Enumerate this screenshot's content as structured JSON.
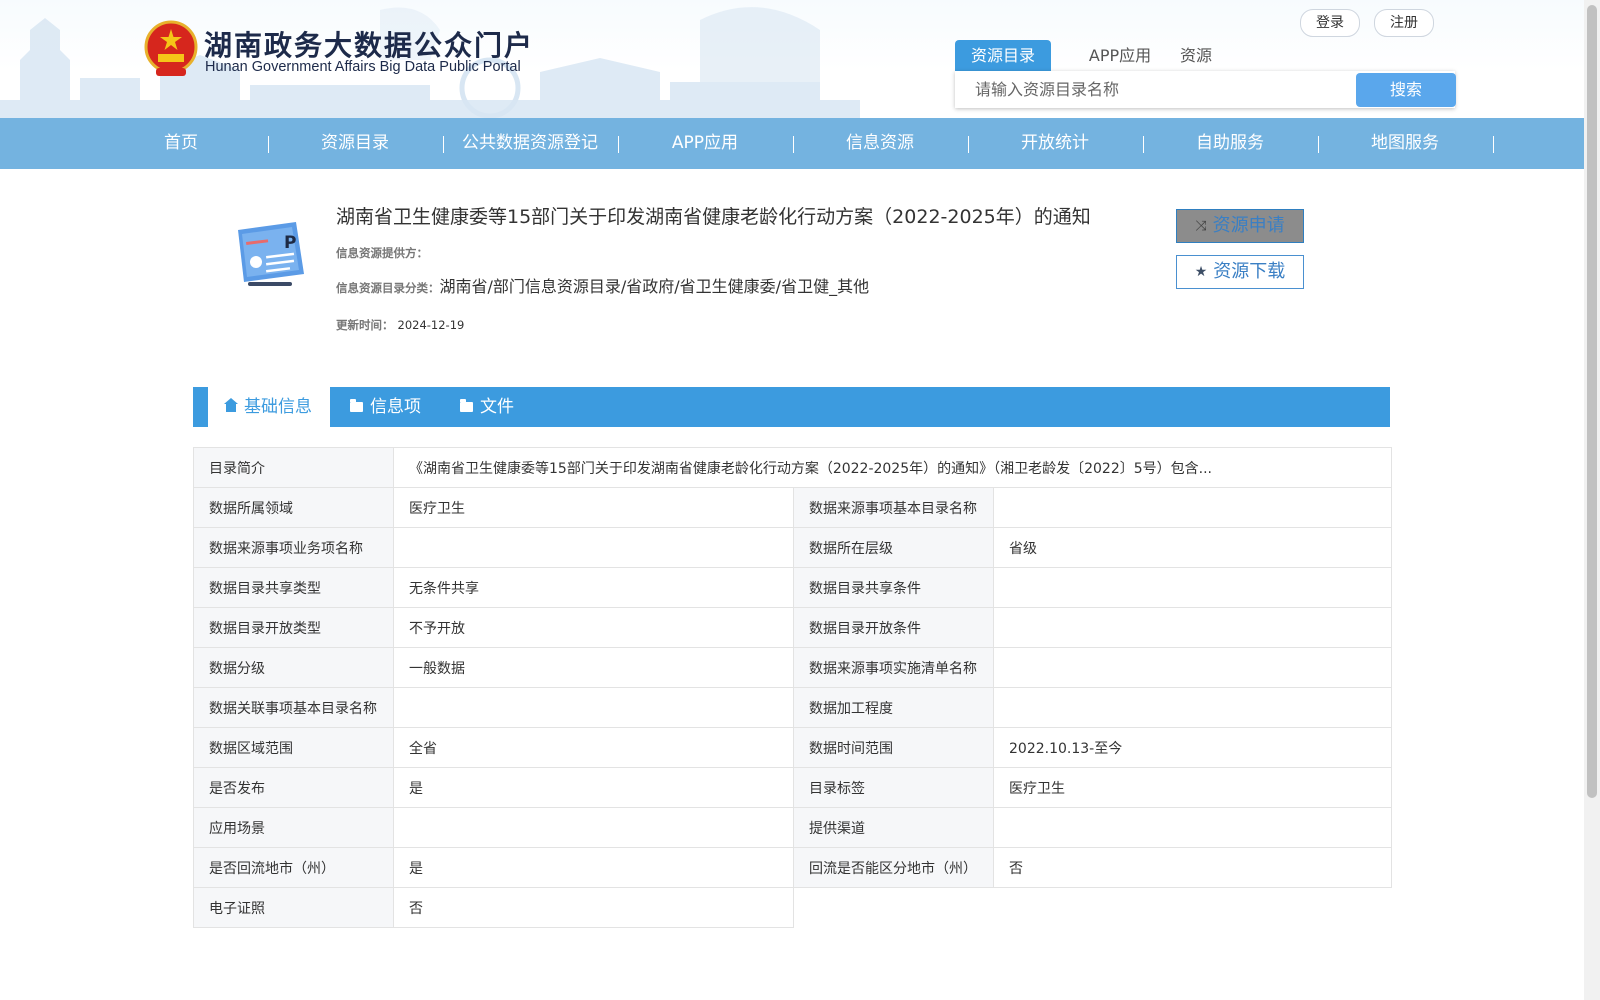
{
  "header": {
    "title_cn": "湖南政务大数据公众门户",
    "title_en": "Hunan Government Affairs Big Data Public Portal",
    "login_label": "登录",
    "register_label": "注册"
  },
  "search": {
    "tabs": [
      "资源目录",
      "APP应用",
      "资源"
    ],
    "placeholder": "请输入资源目录名称",
    "button_label": "搜索"
  },
  "nav": {
    "items": [
      "首页",
      "资源目录",
      "公共数据资源登记",
      "APP应用",
      "信息资源",
      "开放统计",
      "自助服务",
      "地图服务"
    ]
  },
  "resource": {
    "title": "湖南省卫生健康委等15部门关于印发湖南省健康老龄化行动方案（2022-2025年）的通知",
    "provider_label": "信息资源提供方：",
    "provider_value": "",
    "catalog_label": "信息资源目录分类：",
    "catalog_value": "湖南省/部门信息资源目录/省政府/省卫生健康委/省卫健_其他",
    "update_label": "更新时间：",
    "update_value": "2024-12-19",
    "apply_label": "资源申请",
    "download_label": "资源下载"
  },
  "tabs": [
    "基础信息",
    "信息项",
    "文件"
  ],
  "info": {
    "summary_label": "目录简介",
    "summary_value": "《湖南省卫生健康委等15部门关于印发湖南省健康老龄化行动方案（2022-2025年）的通知》（湘卫老龄发〔2022〕5号）包含...",
    "rows": [
      [
        "数据所属领域",
        "医疗卫生",
        "数据来源事项基本目录名称",
        ""
      ],
      [
        "数据来源事项业务项名称",
        "",
        "数据所在层级",
        "省级"
      ],
      [
        "数据目录共享类型",
        "无条件共享",
        "数据目录共享条件",
        ""
      ],
      [
        "数据目录开放类型",
        "不予开放",
        "数据目录开放条件",
        ""
      ],
      [
        "数据分级",
        "一般数据",
        "数据来源事项实施清单名称",
        ""
      ],
      [
        "数据关联事项基本目录名称",
        "",
        "数据加工程度",
        ""
      ],
      [
        "数据区域范围",
        "全省",
        "数据时间范围",
        "2022.10.13-至今"
      ],
      [
        "是否发布",
        "是",
        "目录标签",
        "医疗卫生"
      ],
      [
        "应用场景",
        "",
        "提供渠道",
        ""
      ],
      [
        "是否回流地市（州）",
        "是",
        "回流是否能区分地市（州）",
        "否"
      ],
      [
        "电子证照",
        "否"
      ]
    ]
  },
  "colors": {
    "nav_bg": "#74b3e0",
    "accent": "#3c9bdf",
    "search_btn": "#5aa7ec"
  }
}
